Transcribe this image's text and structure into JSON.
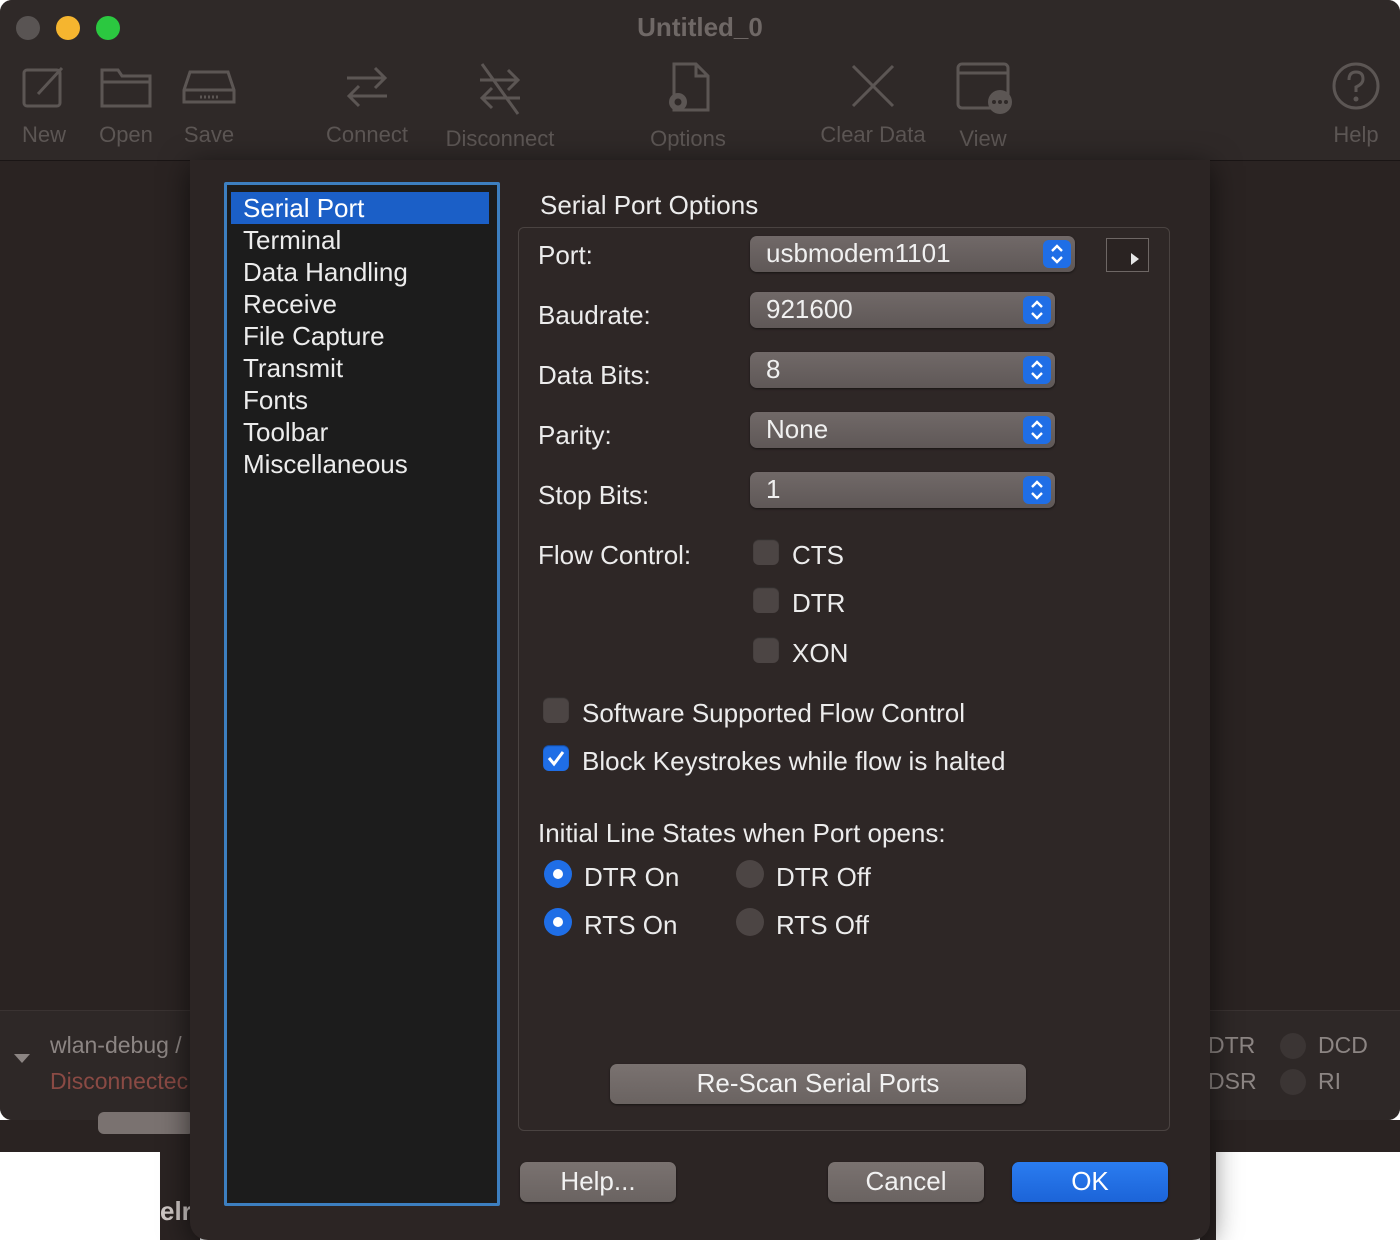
{
  "window": {
    "title": "Untitled_0",
    "toolbar": [
      {
        "name": "new",
        "label": "New",
        "icon": "compose-icon"
      },
      {
        "name": "open",
        "label": "Open",
        "icon": "folder-icon"
      },
      {
        "name": "save",
        "label": "Save",
        "icon": "drive-icon"
      },
      {
        "name": "connect",
        "label": "Connect",
        "icon": "arrows-exchange-icon"
      },
      {
        "name": "disconnect",
        "label": "Disconnect",
        "icon": "arrows-crossed-icon"
      },
      {
        "name": "options",
        "label": "Options",
        "icon": "document-gear-icon"
      },
      {
        "name": "clear-data",
        "label": "Clear Data",
        "icon": "x-icon"
      },
      {
        "name": "view",
        "label": "View",
        "icon": "window-more-icon"
      },
      {
        "name": "help",
        "label": "Help",
        "icon": "question-circle-icon"
      }
    ],
    "status": {
      "device": "wlan-debug /",
      "connection": "Disconnectec",
      "leds_left": [
        "DTR",
        "DSR"
      ],
      "leds_right": [
        "DCD",
        "RI"
      ]
    },
    "underneath_label": "elr"
  },
  "dialog": {
    "sidebar": {
      "items": [
        "Serial Port",
        "Terminal",
        "Data Handling",
        "Receive",
        "File Capture",
        "Transmit",
        "Fonts",
        "Toolbar",
        "Miscellaneous"
      ],
      "selected": "Serial Port"
    },
    "section_title": "Serial Port Options",
    "fields": {
      "port": {
        "label": "Port:",
        "value": "usbmodem1101"
      },
      "baudrate": {
        "label": "Baudrate:",
        "value": "921600"
      },
      "data_bits": {
        "label": "Data Bits:",
        "value": "8"
      },
      "parity": {
        "label": "Parity:",
        "value": "None"
      },
      "stop_bits": {
        "label": "Stop Bits:",
        "value": "1"
      }
    },
    "flow_control": {
      "label": "Flow Control:",
      "options": [
        {
          "label": "CTS",
          "checked": false
        },
        {
          "label": "DTR",
          "checked": false
        },
        {
          "label": "XON",
          "checked": false
        }
      ]
    },
    "software_flow": {
      "label": "Software Supported Flow Control",
      "checked": false
    },
    "block_keystrokes": {
      "label": "Block Keystrokes while flow is halted",
      "checked": true
    },
    "initial_line_states": {
      "label": "Initial Line States when Port opens:",
      "dtr_on": "DTR On",
      "dtr_off": "DTR Off",
      "rts_on": "RTS On",
      "rts_off": "RTS Off",
      "dtr_selected": "DTR On",
      "rts_selected": "RTS On"
    },
    "buttons": {
      "rescan": "Re-Scan Serial Ports",
      "help": "Help...",
      "cancel": "Cancel",
      "ok": "OK"
    },
    "colors": {
      "accent": "#1f6ee6",
      "selection": "#1b5fc7",
      "sidebar_border": "#3d7fc0"
    }
  }
}
